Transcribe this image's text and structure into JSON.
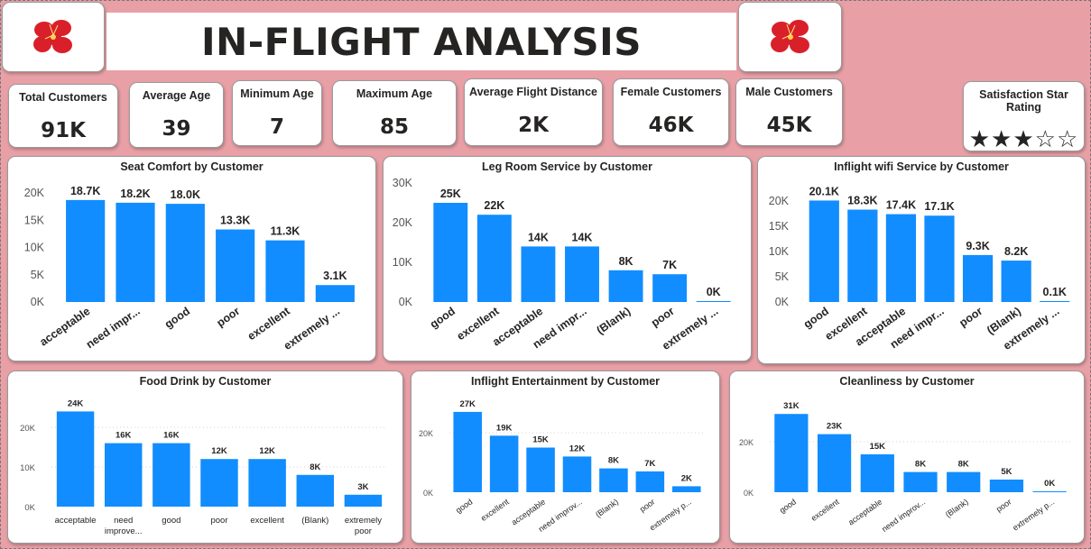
{
  "header": {
    "title": "IN-FLIGHT ANALYSIS"
  },
  "colors": {
    "background": "#e8a0a6",
    "bar": "#118dff",
    "text": "#252423",
    "logo": "#d9202a"
  },
  "kpis": [
    {
      "label": "Total Customers",
      "value": "91K"
    },
    {
      "label": "Average Age",
      "value": "39"
    },
    {
      "label": "Minimum Age",
      "value": "7"
    },
    {
      "label": "Maximum Age",
      "value": "85"
    },
    {
      "label": "Average Flight Distance",
      "value": "2K"
    },
    {
      "label": "Female Customers",
      "value": "46K"
    },
    {
      "label": "Male Customers",
      "value": "45K"
    }
  ],
  "rating": {
    "label": "Satisfaction Star Rating",
    "stars": "★★★☆☆",
    "value": 3,
    "max": 5
  },
  "chart_data": [
    {
      "type": "bar",
      "title": "Seat Comfort by Customer",
      "categories": [
        "acceptable",
        "need impr...",
        "good",
        "poor",
        "excellent",
        "extremely ..."
      ],
      "values": [
        18.7,
        18.2,
        18.0,
        13.3,
        11.3,
        3.1
      ],
      "data_labels": [
        "18.7K",
        "18.2K",
        "18.0K",
        "13.3K",
        "11.3K",
        "3.1K"
      ],
      "yticks": [
        "0K",
        "5K",
        "10K",
        "15K",
        "20K"
      ],
      "ylim": [
        0,
        20
      ],
      "grid": false
    },
    {
      "type": "bar",
      "title": "Leg Room Service by Customer",
      "categories": [
        "good",
        "excellent",
        "acceptable",
        "need impr...",
        "(Blank)",
        "poor",
        "extremely ..."
      ],
      "values": [
        25,
        22,
        14,
        14,
        8,
        7,
        0
      ],
      "data_labels": [
        "25K",
        "22K",
        "14K",
        "14K",
        "8K",
        "7K",
        "0K"
      ],
      "yticks": [
        "0K",
        "10K",
        "20K",
        "30K"
      ],
      "ylim": [
        0,
        30
      ],
      "grid": false
    },
    {
      "type": "bar",
      "title": "Inflight wifi Service by Customer",
      "categories": [
        "good",
        "excellent",
        "acceptable",
        "need impr...",
        "poor",
        "(Blank)",
        "extremely ..."
      ],
      "values": [
        20.1,
        18.3,
        17.4,
        17.1,
        9.3,
        8.2,
        0.1
      ],
      "data_labels": [
        "20.1K",
        "18.3K",
        "17.4K",
        "17.1K",
        "9.3K",
        "8.2K",
        "0.1K"
      ],
      "yticks": [
        "0K",
        "5K",
        "10K",
        "15K",
        "20K"
      ],
      "ylim": [
        0,
        20
      ],
      "grid": false
    },
    {
      "type": "bar",
      "title": "Food Drink by Customer",
      "categories": [
        "acceptable",
        "need improve...",
        "good",
        "poor",
        "excellent",
        "(Blank)",
        "extremely poor"
      ],
      "values": [
        24,
        16,
        16,
        12,
        12,
        8,
        3
      ],
      "data_labels": [
        "24K",
        "16K",
        "16K",
        "12K",
        "12K",
        "8K",
        "3K"
      ],
      "yticks": [
        "0K",
        "10K",
        "20K"
      ],
      "ylim": [
        0,
        20
      ],
      "grid": true
    },
    {
      "type": "bar",
      "title": "Inflight Entertainment by Customer",
      "categories": [
        "good",
        "excellent",
        "acceptable",
        "need improv...",
        "(Blank)",
        "poor",
        "extremely p..."
      ],
      "values": [
        27,
        19,
        15,
        12,
        8,
        7,
        2
      ],
      "data_labels": [
        "27K",
        "19K",
        "15K",
        "12K",
        "8K",
        "7K",
        "2K"
      ],
      "yticks": [
        "0K",
        "20K"
      ],
      "ylim": [
        0,
        20
      ],
      "grid": true
    },
    {
      "type": "bar",
      "title": "Cleanliness by Customer",
      "categories": [
        "good",
        "excellent",
        "acceptable",
        "need improv...",
        "(Blank)",
        "poor",
        "extremely p..."
      ],
      "values": [
        31,
        23,
        15,
        8,
        8,
        5,
        0
      ],
      "data_labels": [
        "31K",
        "23K",
        "15K",
        "8K",
        "8K",
        "5K",
        "0K"
      ],
      "yticks": [
        "0K",
        "20K"
      ],
      "ylim": [
        0,
        20
      ],
      "grid": true
    }
  ]
}
